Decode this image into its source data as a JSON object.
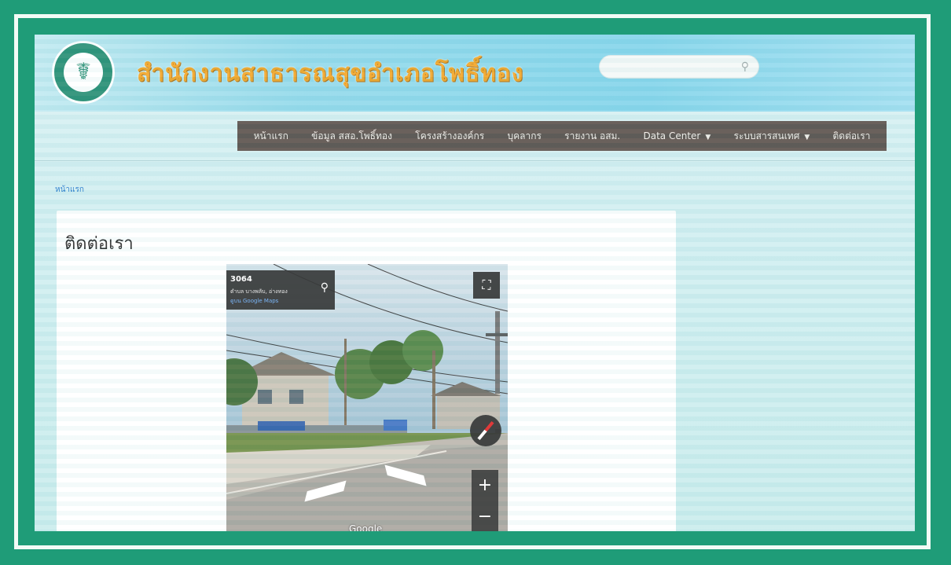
{
  "header": {
    "site_title": "สำนักงานสาธารณสุขอำเภอโพธิ์ทอง",
    "search_placeholder": ""
  },
  "nav": {
    "items": [
      {
        "label": "หน้าแรก",
        "dropdown": false
      },
      {
        "label": "ข้อมูล สสอ.โพธิ์ทอง",
        "dropdown": false
      },
      {
        "label": "โครงสร้างองค์กร",
        "dropdown": false
      },
      {
        "label": "บุคลากร",
        "dropdown": false
      },
      {
        "label": "รายงาน อสม.",
        "dropdown": false
      },
      {
        "label": "Data Center",
        "dropdown": true
      },
      {
        "label": "ระบบสารสนเทศ",
        "dropdown": true
      },
      {
        "label": "ติดต่อเรา",
        "dropdown": false
      }
    ]
  },
  "breadcrumb": "หน้าแรก",
  "page_title": "ติดต่อเรา",
  "streetview": {
    "title": "3064",
    "subtitle": "ตำบล บางพลับ, อ่างทอง",
    "link": "ดูบน Google Maps",
    "watermark": "Google"
  },
  "colors": {
    "frame": "#1f9c78",
    "nav_bg": "#554b46",
    "title": "#f2a21e"
  }
}
